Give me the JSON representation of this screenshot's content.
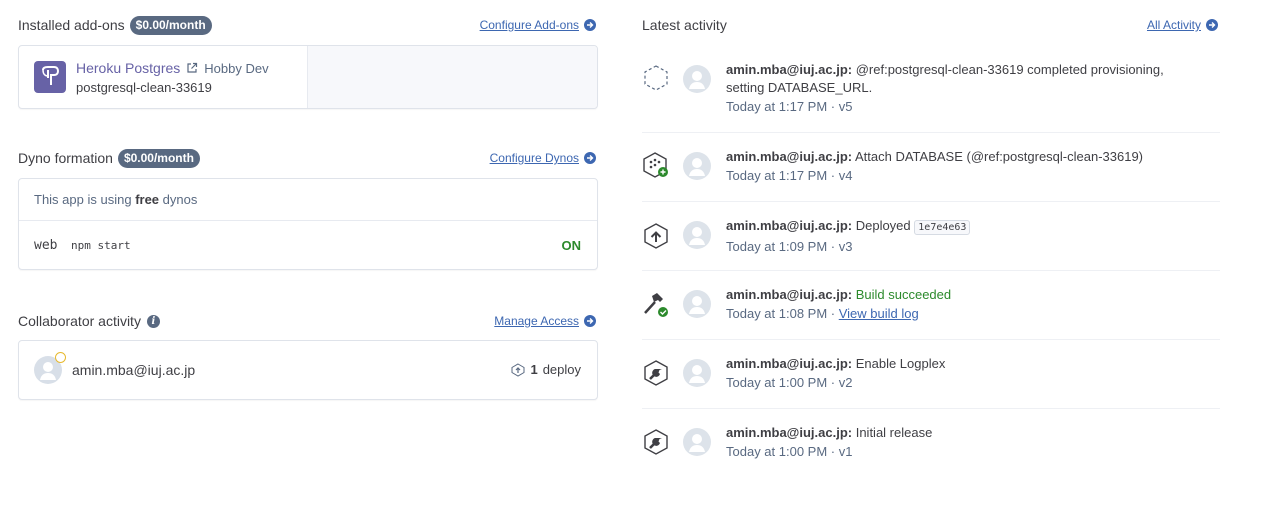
{
  "addons": {
    "title": "Installed add-ons",
    "cost": "$0.00/month",
    "configure_link": "Configure Add-ons",
    "item": {
      "name": "Heroku Postgres",
      "plan": "Hobby Dev",
      "id": "postgresql-clean-33619"
    }
  },
  "dynos": {
    "title": "Dyno formation",
    "cost": "$0.00/month",
    "configure_link": "Configure Dynos",
    "notice_prefix": "This app is using",
    "notice_bold": "free",
    "notice_suffix": "dynos",
    "process": {
      "type": "web",
      "command": "npm start",
      "status": "ON"
    }
  },
  "collaborators": {
    "title": "Collaborator activity",
    "manage_link": "Manage Access",
    "item": {
      "email": "amin.mba@iuj.ac.jp",
      "count": "1",
      "count_label": "deploy"
    }
  },
  "activity": {
    "title": "Latest activity",
    "all_link": "All Activity",
    "items": [
      {
        "icon": "provisioning-icon",
        "user": "amin.mba@iuj.ac.jp:",
        "message": "@ref:postgresql-clean-33619 completed provisioning, setting DATABASE_URL.",
        "meta": "Today at 1:17 PM · v5"
      },
      {
        "icon": "attach-database-icon",
        "user": "amin.mba@iuj.ac.jp:",
        "message": "Attach DATABASE (@ref:postgresql-clean-33619)",
        "meta": "Today at 1:17 PM · v4"
      },
      {
        "icon": "deploy-icon",
        "user": "amin.mba@iuj.ac.jp:",
        "message": "Deployed",
        "commit": "1e7e4e63",
        "meta": "Today at 1:09 PM · v3"
      },
      {
        "icon": "build-icon",
        "user": "amin.mba@iuj.ac.jp:",
        "message": "Build succeeded",
        "meta": "Today at 1:08 PM · ",
        "meta_link": "View build log"
      },
      {
        "icon": "wrench-icon",
        "user": "amin.mba@iuj.ac.jp:",
        "message": "Enable Logplex",
        "meta": "Today at 1:00 PM · v2"
      },
      {
        "icon": "wrench-icon",
        "user": "amin.mba@iuj.ac.jp:",
        "message": "Initial release",
        "meta": "Today at 1:00 PM · v1"
      }
    ]
  },
  "colors": {
    "link": "#3d67b1",
    "badge": "#596981",
    "postgres": "#6762a6",
    "success": "#2c8a2c"
  }
}
